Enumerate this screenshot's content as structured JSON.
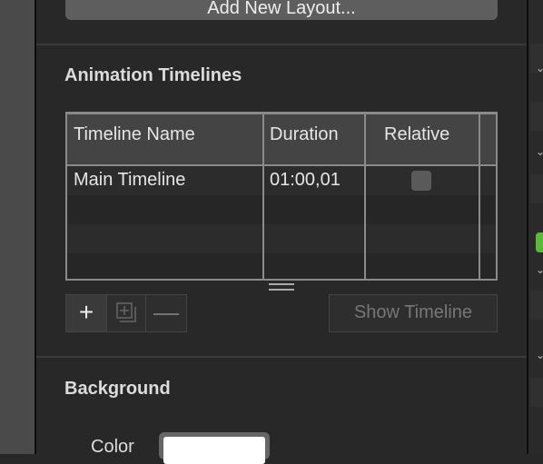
{
  "layouts": {
    "add_button": "Add New Layout..."
  },
  "timelines": {
    "title": "Animation Timelines",
    "columns": [
      "Timeline Name",
      "Duration",
      "Relative"
    ],
    "rows": [
      {
        "name": "Main Timeline",
        "duration": "01:00,01",
        "relative": false
      }
    ],
    "add_icon": "plus-icon",
    "duplicate_icon": "duplicate-icon",
    "remove_icon": "minus-icon",
    "show_button": "Show Timeline"
  },
  "background": {
    "title": "Background",
    "color_label": "Color",
    "color_value": "#ffffff"
  }
}
